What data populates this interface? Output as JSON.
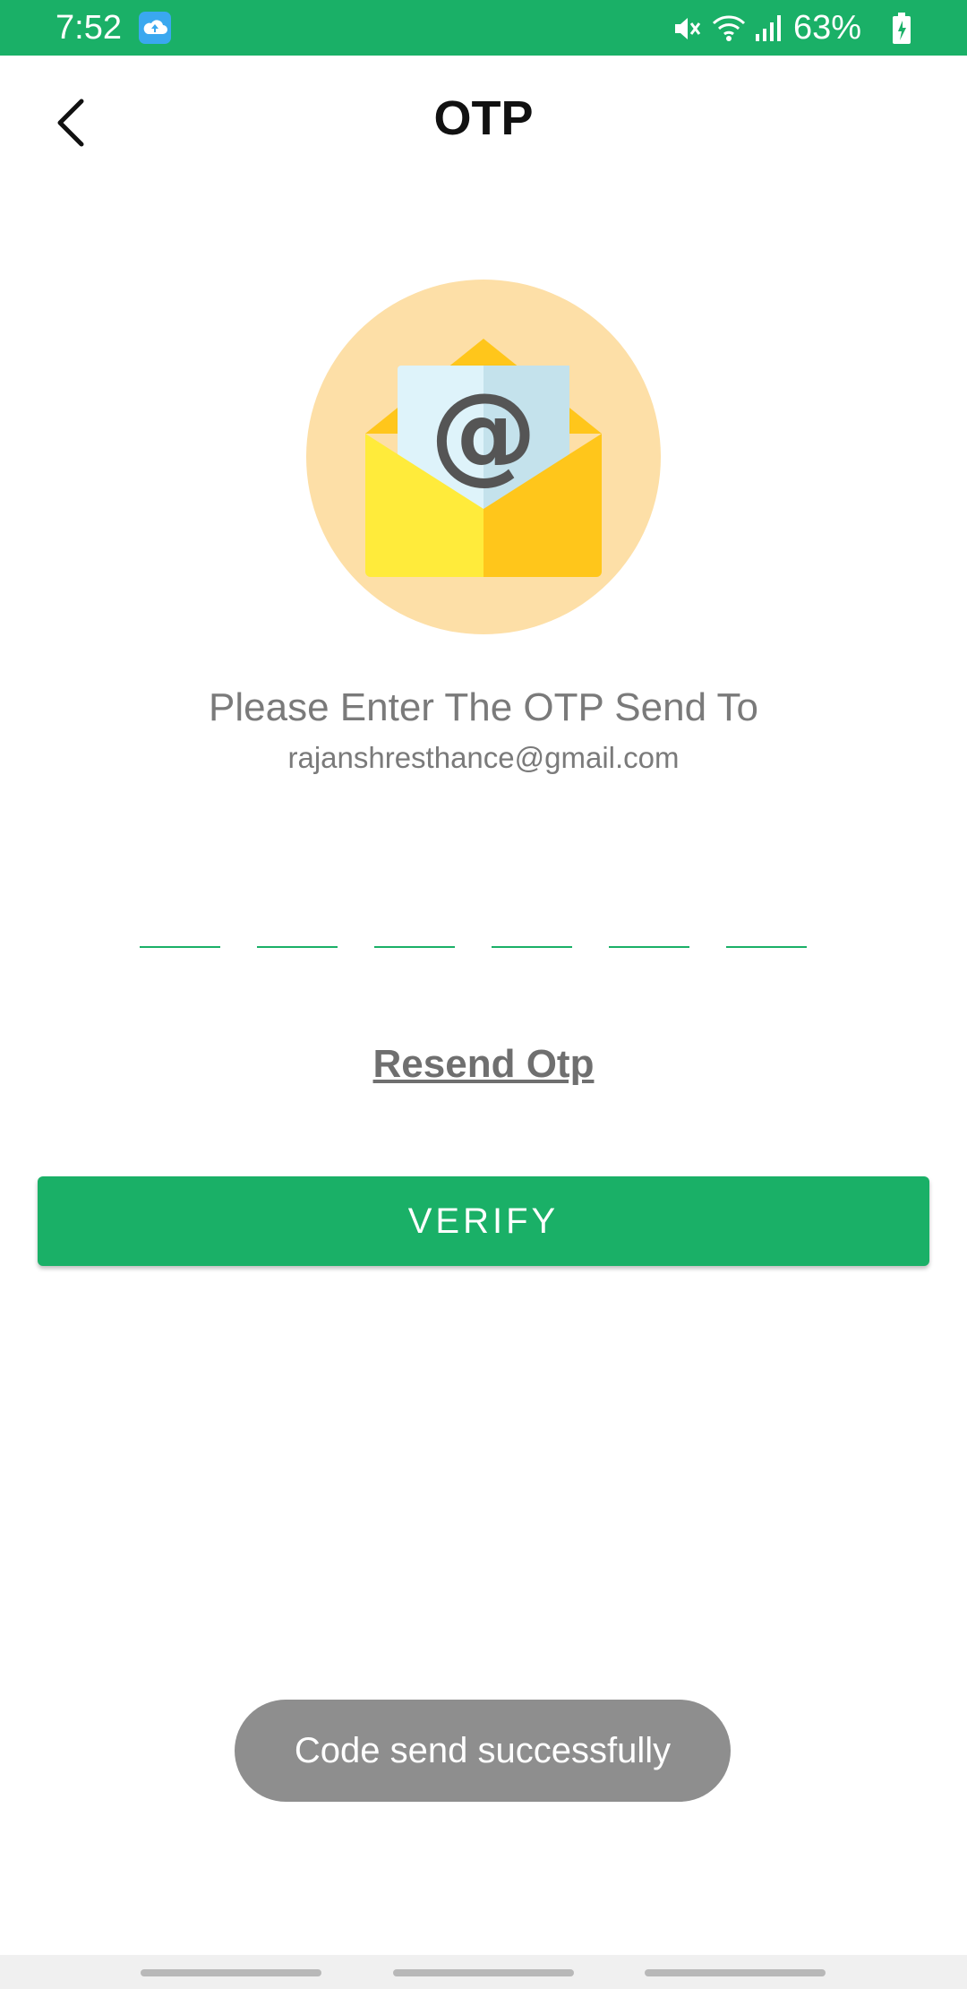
{
  "status_bar": {
    "time": "7:52",
    "battery_percent": "63%",
    "app_icon": "cloud-upload-icon",
    "icons": [
      "mute-icon",
      "wifi-icon",
      "signal-icon",
      "battery-icon"
    ],
    "background_color": "#1ab067"
  },
  "header": {
    "title": "OTP",
    "back_icon": "back-arrow-icon"
  },
  "illustration": {
    "icon": "email-envelope-icon"
  },
  "main": {
    "prompt": "Please Enter The OTP Send To",
    "email": "rajanshresthance@gmail.com",
    "otp_fields": [
      "",
      "",
      "",
      "",
      "",
      ""
    ],
    "resend_label": "Resend Otp",
    "verify_label": "VERIFY"
  },
  "toast": {
    "message": "Code send successfully"
  },
  "colors": {
    "accent": "#1ab067",
    "toast_background": "#8e8e8e",
    "text_secondary": "#7a7a7a"
  }
}
